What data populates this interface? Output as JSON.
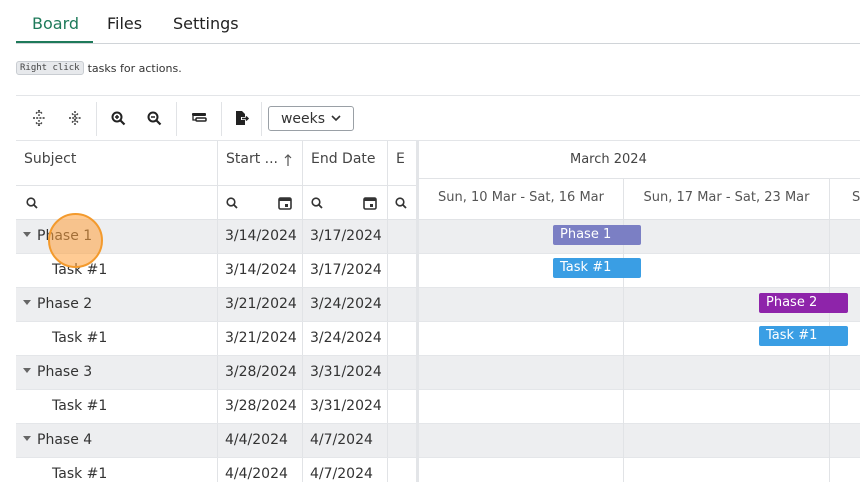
{
  "tabs": [
    {
      "label": "Board",
      "active": true
    },
    {
      "label": "Files",
      "active": false
    },
    {
      "label": "Settings",
      "active": false
    }
  ],
  "hint": {
    "key": "Right click",
    "text": "tasks for actions."
  },
  "toolbar": {
    "buttons": [
      "expand-all-icon",
      "collapse-all-icon",
      "zoom-in-icon",
      "zoom-out-icon",
      "indent-icon",
      "export-icon"
    ],
    "zoom_value": "weeks"
  },
  "grid": {
    "columns": {
      "subject": "Subject",
      "start": "Start ...",
      "end": "End Date",
      "extra": "E"
    },
    "rows": [
      {
        "type": "phase",
        "subject": "Phase 1",
        "start": "3/14/2024",
        "end": "3/17/2024"
      },
      {
        "type": "task",
        "subject": "Task #1",
        "start": "3/14/2024",
        "end": "3/17/2024"
      },
      {
        "type": "phase",
        "subject": "Phase 2",
        "start": "3/21/2024",
        "end": "3/24/2024"
      },
      {
        "type": "task",
        "subject": "Task #1",
        "start": "3/21/2024",
        "end": "3/24/2024"
      },
      {
        "type": "phase",
        "subject": "Phase 3",
        "start": "3/28/2024",
        "end": "3/31/2024"
      },
      {
        "type": "task",
        "subject": "Task #1",
        "start": "3/28/2024",
        "end": "3/31/2024"
      },
      {
        "type": "phase",
        "subject": "Phase 4",
        "start": "4/4/2024",
        "end": "4/7/2024"
      },
      {
        "type": "task",
        "subject": "Task #1",
        "start": "4/4/2024",
        "end": "4/7/2024"
      }
    ]
  },
  "timeline": {
    "month": "March 2024",
    "weeks": [
      "Sun, 10 Mar - Sat, 16 Mar",
      "Sun, 17 Mar - Sat, 23 Mar",
      "S"
    ],
    "bars": [
      {
        "label": "Phase 1",
        "color": "#7b7fc4"
      },
      {
        "label": "Task #1",
        "color": "#3a9ee4"
      },
      {
        "label": "Phase 2",
        "color": "#8e24aa"
      },
      {
        "label": "Task #1",
        "color": "#3a9ee4"
      }
    ]
  },
  "colors": {
    "accent": "#1e7a5a",
    "click_indicator": "#f39a2d"
  }
}
